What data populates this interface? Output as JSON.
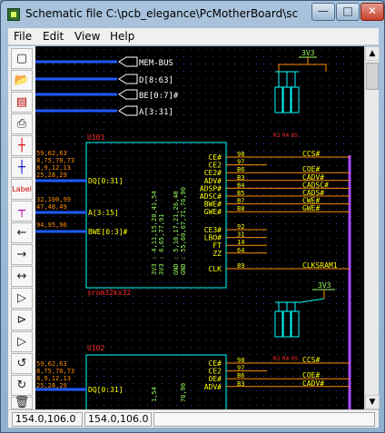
{
  "window": {
    "title": "Schematic file C:\\pcb_elegance\\PcMotherBoard\\sch..."
  },
  "titlebar_buttons": [
    "minimize",
    "maximize",
    "close"
  ],
  "menu": {
    "file": "File",
    "edit": "Edit",
    "view": "View",
    "help": "Help"
  },
  "toolbar": {
    "tools": [
      "select-icon",
      "open-icon",
      "save-icon",
      "print-icon",
      "wire-red-icon",
      "wire-blue-icon",
      "Label",
      "bus-tap-icon",
      "pin-left-icon",
      "pin-right-icon",
      "pin-both-icon",
      "gate-icon",
      "gate-icon",
      "gate-icon",
      "undo-icon",
      "redo-icon",
      "delete-icon",
      "copy-icon"
    ],
    "label_text": "Label"
  },
  "schematic": {
    "bus_labels": [
      "MEM-BUS",
      "D[8:63]",
      "BE[0:7]#",
      "A[3:31]"
    ],
    "top_component": {
      "ref": "U101",
      "part": "srom32kx32",
      "power_pins": "3V3 : 4,11,15,20,41,54",
      "power_pins_b": "3V3 : 6,65,77,91",
      "gnd_pins": "GND : 5,10,17,21,26,40",
      "gnd_pins_b": "GND : 55,60,67,71,76,90",
      "left_pin_groups": [
        {
          "numbers": "59,62,63\n8,75,70,73\n8,9,12,13\n25,28,29",
          "label": "DQ[0:31]"
        },
        {
          "numbers": "32,100,99\n47,48,49",
          "label": "A[3:15]"
        },
        {
          "numbers": "94,95,96",
          "label": "BWE[0:3]#"
        }
      ],
      "right_pins": [
        {
          "name": "CE#",
          "num": "98",
          "net": "CCS#"
        },
        {
          "name": "CE2",
          "num": "97",
          "net": ""
        },
        {
          "name": "CE2#",
          "num": "B6",
          "net": "COE#"
        },
        {
          "name": "ADV#",
          "num": "B3",
          "net": "CADV#"
        },
        {
          "name": "ADSP#",
          "num": "B4",
          "net": "CADSC#"
        },
        {
          "name": "ADSC#",
          "num": "B5",
          "net": "CADS#"
        },
        {
          "name": "BWE#",
          "num": "B7",
          "net": "CWE#"
        },
        {
          "name": "GWE#",
          "num": "B8",
          "net": "GWE#"
        },
        {
          "name": "CE3#",
          "num": "92",
          "net": ""
        },
        {
          "name": "LBO#",
          "num": "31",
          "net": ""
        },
        {
          "name": "FT",
          "num": "14",
          "net": ""
        },
        {
          "name": "ZZ",
          "num": "64",
          "net": ""
        },
        {
          "name": "CLK",
          "num": "89",
          "net": "CLKSRAM1"
        }
      ]
    },
    "bottom_component": {
      "ref": "U102",
      "left_pin_groups": [
        {
          "numbers": "59,62,63\n8,75,70,73\n8,9,12,13\n25,28,29",
          "label": "DQ[0:31]"
        }
      ],
      "power_pins": "1,54",
      "gnd_pins": "76,90",
      "right_pins": [
        {
          "name": "CE#",
          "num": "98",
          "net": "CCS#"
        },
        {
          "name": "CE2",
          "num": "97",
          "net": ""
        },
        {
          "name": "OE#",
          "num": "B6",
          "net": "COE#"
        },
        {
          "name": "ADV#",
          "num": "B3",
          "net": "CADV#"
        }
      ]
    },
    "power_labels": [
      "3V3",
      "3V3"
    ],
    "resistor_labels": [
      "R3",
      "R4",
      "R5"
    ]
  },
  "status": {
    "left": "154.0,106.0",
    "right": "154.0,106.0"
  },
  "colors": {
    "component": "#00ffff",
    "wire": "#ff8c00",
    "bus": "#1e5bff",
    "text": "#ffffff",
    "pin": "#ffff00",
    "power": "#9aff5a",
    "resistor": "#ff2a2a",
    "grid": "#4040a0"
  }
}
